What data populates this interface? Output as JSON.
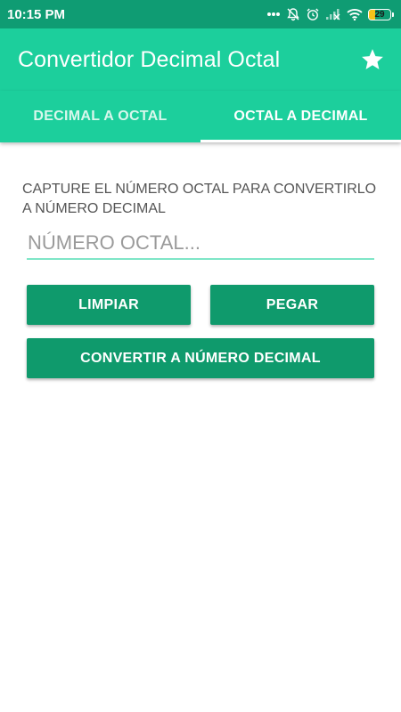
{
  "status_bar": {
    "time": "10:15 PM",
    "battery_level": "29",
    "battery_fill_percent": 29,
    "icons": [
      "notification-dots-icon",
      "bell-off-icon",
      "alarm-clock-icon",
      "signal-off-icon",
      "wifi-icon",
      "battery-icon"
    ]
  },
  "app_bar": {
    "title": "Convertidor Decimal Octal",
    "action_icon": "star-icon"
  },
  "tabs": [
    {
      "label": "DECIMAL A OCTAL",
      "active": false
    },
    {
      "label": "OCTAL A DECIMAL",
      "active": true
    }
  ],
  "main": {
    "instruction": "CAPTURE EL NÚMERO OCTAL PARA CONVERTIRLO A NÚMERO DECIMAL",
    "input": {
      "value": "",
      "placeholder": "NÚMERO OCTAL..."
    },
    "clear_label": "LIMPIAR",
    "paste_label": "PEGAR",
    "convert_label": "CONVERTIR A NÚMERO DECIMAL"
  },
  "colors": {
    "status_bar": "#0f9c73",
    "primary": "#1ccf9c",
    "button": "#0f9a6c",
    "input_underline": "#7fe6c7",
    "battery": "#f6c21a"
  }
}
